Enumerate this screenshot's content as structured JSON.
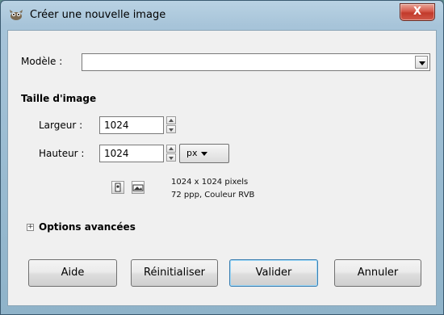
{
  "window": {
    "title": "Créer une nouvelle image",
    "close_glyph": "X"
  },
  "template": {
    "label": "Modèle :",
    "value": ""
  },
  "image_size": {
    "heading": "Taille d'image",
    "width_label": "Largeur :",
    "width_value": "1024",
    "height_label": "Hauteur :",
    "height_value": "1024",
    "unit": "px",
    "info_line1": "1024 x 1024 pixels",
    "info_line2": "72 ppp, Couleur RVB"
  },
  "advanced": {
    "label": "Options avancées",
    "expander_glyph": "+"
  },
  "buttons": {
    "help": "Aide",
    "reset": "Réinitialiser",
    "ok": "Valider",
    "cancel": "Annuler"
  },
  "colors": {
    "frame": "#a7c4d9",
    "client_bg": "#f0f0f0",
    "close_red": "#c23a2b",
    "default_border": "#3c7fb1"
  }
}
